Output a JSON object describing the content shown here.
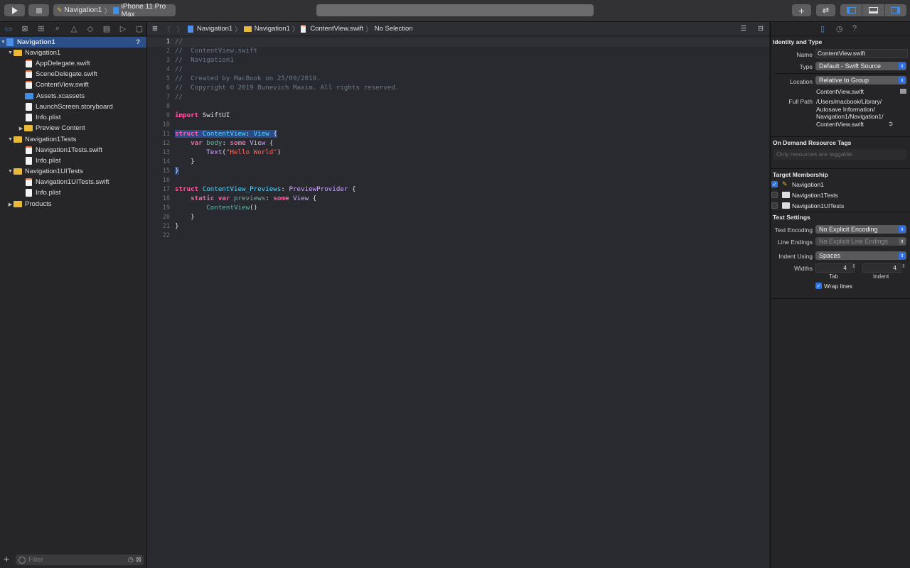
{
  "toolbar": {
    "scheme": "Navigation1",
    "device": "iPhone 11 Pro Max",
    "add_label": "+"
  },
  "navigator": {
    "rows": [
      {
        "label": "Navigation1",
        "badge": "?"
      },
      {
        "label": "Navigation1"
      },
      {
        "label": "AppDelegate.swift"
      },
      {
        "label": "SceneDelegate.swift"
      },
      {
        "label": "ContentView.swift"
      },
      {
        "label": "Assets.xcassets"
      },
      {
        "label": "LaunchScreen.storyboard"
      },
      {
        "label": "Info.plist"
      },
      {
        "label": "Preview Content"
      },
      {
        "label": "Navigation1Tests"
      },
      {
        "label": "Navigation1Tests.swift"
      },
      {
        "label": "Info.plist"
      },
      {
        "label": "Navigation1UITests"
      },
      {
        "label": "Navigation1UITests.swift"
      },
      {
        "label": "Info.plist"
      },
      {
        "label": "Products"
      }
    ],
    "filter_placeholder": "Filter",
    "add_label": "+"
  },
  "jumpbar": {
    "crumbs": [
      "Navigation1",
      "Navigation1",
      "ContentView.swift",
      "No Selection"
    ]
  },
  "code": {
    "line_numbers": [
      "1",
      "2",
      "3",
      "4",
      "5",
      "6",
      "7",
      "8",
      "9",
      "10",
      "11",
      "12",
      "13",
      "14",
      "15",
      "16",
      "17",
      "18",
      "19",
      "20",
      "21",
      "22"
    ],
    "l1": "//",
    "l2": "//  ContentView.swift",
    "l3": "//  Navigation1",
    "l4": "//",
    "l5": "//  Created by MacBook on 25/09/2019.",
    "l6": "//  Copyright © 2019 Bunevich Maxim. All rights reserved.",
    "l7": "//",
    "l9": [
      "import",
      " SwiftUI"
    ],
    "l11": [
      "struct",
      " ContentView",
      ": ",
      "View",
      " {"
    ],
    "l12": [
      "    ",
      "var",
      " ",
      "body",
      ": ",
      "some",
      " ",
      "View",
      " {"
    ],
    "l13": [
      "        ",
      "Text",
      "(",
      "\"Hello World\"",
      ")"
    ],
    "l14": "    }",
    "l15": "}",
    "l17": [
      "struct",
      " ContentView_Previews",
      ": ",
      "PreviewProvider",
      " {"
    ],
    "l18": [
      "    ",
      "static",
      " ",
      "var",
      " ",
      "previews",
      ": ",
      "some",
      " ",
      "View",
      " {"
    ],
    "l19": [
      "        ",
      "ContentView",
      "()"
    ],
    "l20": "    }",
    "l21": "}"
  },
  "inspector": {
    "identity_header": "Identity and Type",
    "name_label": "Name",
    "name_value": "ContentView.swift",
    "type_label": "Type",
    "type_value": "Default - Swift Source",
    "location_label": "Location",
    "location_value": "Relative to Group",
    "location_file": "ContentView.swift",
    "fullpath_label": "Full Path",
    "fullpath_lines": [
      "/Users/macbook/Library/",
      "Autosave Information/",
      "Navigation1/Navigation1/",
      "ContentView.swift"
    ],
    "odr_header": "On Demand Resource Tags",
    "odr_placeholder": "Only resources are taggable",
    "target_header": "Target Membership",
    "targets": [
      {
        "label": "Navigation1",
        "checked": true
      },
      {
        "label": "Navigation1Tests",
        "checked": false
      },
      {
        "label": "Navigation1UITests",
        "checked": false
      }
    ],
    "text_header": "Text Settings",
    "encoding_label": "Text Encoding",
    "encoding_value": "No Explicit Encoding",
    "endings_label": "Line Endings",
    "endings_value": "No Explicit Line Endings",
    "indent_label": "Indent Using",
    "indent_value": "Spaces",
    "widths_label": "Widths",
    "tab_value": "4",
    "indent_width_value": "4",
    "tab_caption": "Tab",
    "indent_caption": "Indent",
    "wrap_label": "Wrap lines",
    "wrap_checked": true
  },
  "colors": {
    "accent": "#2f75e8",
    "selection": "#2c4f87",
    "keyword": "#fc5fa3",
    "type": "#5dd8ff",
    "string": "#fc6a5d",
    "comment": "#6c7986"
  }
}
